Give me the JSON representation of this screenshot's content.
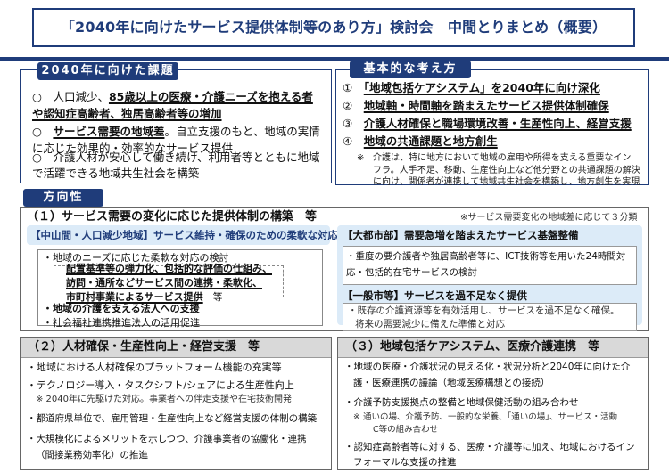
{
  "title": "「2040年に向けたサービス提供体制等のあり方」検討会　中間とりまとめ（概要）",
  "issues": {
    "heading": "2040年に向けた課題",
    "items": [
      {
        "bullet": "○",
        "lead": "人口減少、",
        "underline": "85歳以上の医療・介護ニーズを抱える者",
        "line2": "や認知症高齢者、独居高齢者等の増加"
      },
      {
        "bullet": "○",
        "underline": "サービス需要の地域差",
        "rest": "。自立支援のもと、地域の実情",
        "line2": "に応じた効果的・効率的なサービス提供"
      },
      {
        "bullet": "○",
        "lead": "介護人材が安心して働き続け、利用者等とともに地域",
        "line2": "で活躍できる地域共生社会を構築"
      }
    ]
  },
  "basic": {
    "heading": "基本的な考え方",
    "items": [
      {
        "num": "①",
        "text": "「地域包括ケアシステム」を2040年に向け深化"
      },
      {
        "num": "②",
        "text": "地域軸・時間軸を踏まえたサービス提供体制確保"
      },
      {
        "num": "③",
        "text": "介護人材確保と職場環境改善・生産性向上、経営支援"
      },
      {
        "num": "④",
        "text": "地域の共通課題と地方創生"
      }
    ],
    "note_mark": "※",
    "note_lines": [
      "介護は、特に地方において地域の雇用や所得を支える重要なイン",
      "フラ。人手不足、移動、生産性向上など他分野との共通課題の解決",
      "に向け、関係者が連携して地域共生社会を構築し、地方創生を実現"
    ]
  },
  "direction": {
    "heading": "方向性",
    "section1": {
      "title": "（１）サービス需要の変化に応じた提供体制の構築　等",
      "note": "※サービス需要変化の地域差に応じて３分類",
      "left": {
        "header": "【中山間・人口減少地域】サービス維持・確保のための柔軟な対応",
        "lines": [
          "・地域のニーズに応じた柔軟な対応の検討",
          "配置基準等の弾力化、包括的な評価の仕組み、",
          "訪問・通所などサービス間の連携・柔軟化、",
          "市町村事業によるサービス提供",
          "等",
          "・地域の介護を支える法人への支援",
          "・社会福祉連携推進法人の活用促進"
        ]
      },
      "right": {
        "header1": "【大都市部】需要急増を踏まえたサービス基盤整備",
        "lines1": [
          "・重度の要介護者や独居高齢者等に、ICT技術等を用いた24時間対",
          "応・包括的在宅サービスの検討"
        ],
        "header2": "【一般市等】サービスを過不足なく提供",
        "lines2": [
          "・既存の介護資源等を有効活用し、サービスを過不足なく確保。",
          "将来の需要減少に備えた準備と対応"
        ]
      }
    },
    "section2": {
      "title": "（２）人材確保・生産性向上・経営支援　等",
      "items": [
        {
          "text": "・地域における人材確保のプラットフォーム機能の充実等"
        },
        {
          "text": "・テクノロジー導入・タスクシフト/シェアによる生産性向上",
          "note": "※ 2040年に先駆けた対応。事業者への伴走支援や在宅技術開発"
        },
        {
          "text": "・都道府県単位で、雇用管理・生産性向上など経営支援の体制の構築"
        },
        {
          "text": "・大規模化によるメリットを示しつつ、介護事業者の協働化・連携",
          "line2": "（間接業務効率化）の推進"
        }
      ]
    },
    "section3": {
      "title": "（３）地域包括ケアシステム、医療介護連携　等",
      "items": [
        {
          "text": "・地域の医療・介護状況の見える化・状況分析と2040年に向けた介",
          "line2": "護・医療連携の議論（地域医療構想との接続）"
        },
        {
          "text": "・介護予防支援拠点の整備と地域保健活動の組み合わせ",
          "note": "※ 通いの場、介護予防、一般的な栄養、「通いの場」、サービス・活動",
          "note2": "C等の組み合わせ"
        },
        {
          "text": "・認知症高齢者等に対する、医療・介護等に加え、地域におけるイン",
          "line2": "フォーマルな支援の推進"
        }
      ]
    }
  },
  "colors": {
    "navy": "#1f3c7a",
    "light_blue": "#dcebf8",
    "grey_header": "#d9d9d9"
  }
}
